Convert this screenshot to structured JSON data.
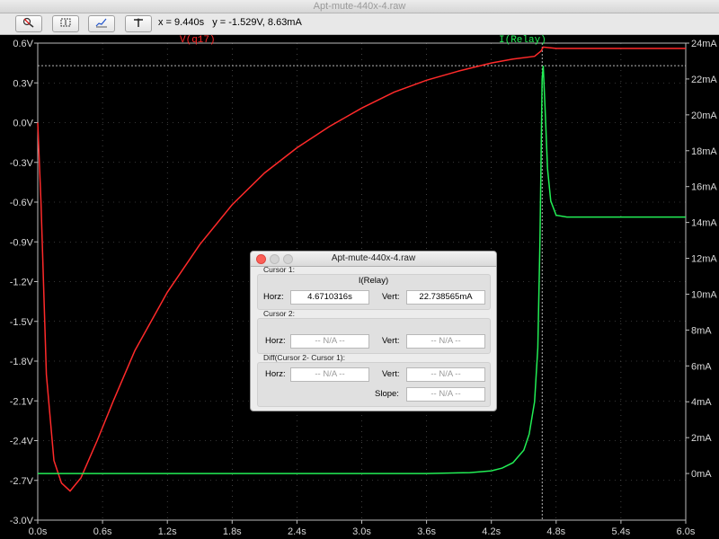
{
  "window": {
    "title": "Apt-mute-440x-4.raw"
  },
  "toolbar": {
    "buttons": [
      "zoom-out-icon",
      "zoom-fit-icon",
      "autorange-icon",
      "probe-icon"
    ],
    "readout": "x = 9.440s   y = -1.529V, 8.63mA"
  },
  "plot": {
    "left_trace_label": "V(q17)",
    "right_trace_label": "I(Relay)",
    "colors": {
      "voltage": "#ff2a2a",
      "current": "#22ee55",
      "grid": "#6a6a6a",
      "axis": "#bdbdbd"
    }
  },
  "chart_data": {
    "type": "line",
    "x_label": "",
    "x_ticks": [
      "0.0s",
      "0.6s",
      "1.2s",
      "1.8s",
      "2.4s",
      "3.0s",
      "3.6s",
      "4.2s",
      "4.8s",
      "5.4s",
      "6.0s"
    ],
    "xlim": [
      0,
      6.0
    ],
    "y_left_ticks": [
      "0.6V",
      "0.3V",
      "0.0V",
      "-0.3V",
      "-0.6V",
      "-0.9V",
      "-1.2V",
      "-1.5V",
      "-1.8V",
      "-2.1V",
      "-2.4V",
      "-2.7V",
      "-3.0V"
    ],
    "y_left_lim": [
      -3.0,
      0.6
    ],
    "y_right_ticks": [
      "24mA",
      "22mA",
      "20mA",
      "18mA",
      "16mA",
      "14mA",
      "12mA",
      "10mA",
      "8mA",
      "6mA",
      "4mA",
      "2mA",
      "0mA"
    ],
    "y_right_lim": [
      -2.6,
      24
    ],
    "cursor": {
      "x": 4.671,
      "y_mA": 22.74
    },
    "series": [
      {
        "name": "V(q17)",
        "axis": "left",
        "x": [
          0.0,
          0.03,
          0.08,
          0.15,
          0.22,
          0.3,
          0.4,
          0.55,
          0.7,
          0.9,
          1.2,
          1.5,
          1.8,
          2.1,
          2.4,
          2.7,
          3.0,
          3.3,
          3.6,
          3.9,
          4.2,
          4.4,
          4.6,
          4.66,
          4.68,
          4.8,
          5.4,
          6.0
        ],
        "y": [
          0.0,
          -0.6,
          -1.9,
          -2.55,
          -2.72,
          -2.78,
          -2.68,
          -2.4,
          -2.1,
          -1.72,
          -1.28,
          -0.92,
          -0.62,
          -0.38,
          -0.19,
          -0.03,
          0.11,
          0.23,
          0.32,
          0.39,
          0.45,
          0.48,
          0.5,
          0.54,
          0.57,
          0.56,
          0.56,
          0.56
        ]
      },
      {
        "name": "I(Relay)",
        "axis": "right",
        "x": [
          0.0,
          1.0,
          2.0,
          3.0,
          3.6,
          4.0,
          4.2,
          4.3,
          4.4,
          4.5,
          4.55,
          4.6,
          4.63,
          4.65,
          4.67,
          4.68,
          4.7,
          4.72,
          4.75,
          4.8,
          4.9,
          5.0,
          6.0
        ],
        "y": [
          0.0,
          0.0,
          0.0,
          0.0,
          0.0,
          0.05,
          0.15,
          0.3,
          0.6,
          1.3,
          2.2,
          4.0,
          7.0,
          13.0,
          22.0,
          22.74,
          20.0,
          17.0,
          15.2,
          14.4,
          14.3,
          14.3,
          14.3
        ]
      }
    ]
  },
  "dialog": {
    "title": "Apt-mute-440x-4.raw",
    "cursor1": {
      "section": "Cursor 1:",
      "trace": "I(Relay)",
      "horz_label": "Horz:",
      "horz": "4.6710316s",
      "vert_label": "Vert:",
      "vert": "22.738565mA"
    },
    "cursor2": {
      "section": "Cursor 2:",
      "horz_label": "Horz:",
      "horz": "-- N/A --",
      "vert_label": "Vert:",
      "vert": "-- N/A --"
    },
    "diff": {
      "section": "Diff(Cursor 2- Cursor 1):",
      "horz_label": "Horz:",
      "horz": "-- N/A --",
      "vert_label": "Vert:",
      "vert": "-- N/A --",
      "slope_label": "Slope:",
      "slope": "-- N/A --"
    }
  }
}
